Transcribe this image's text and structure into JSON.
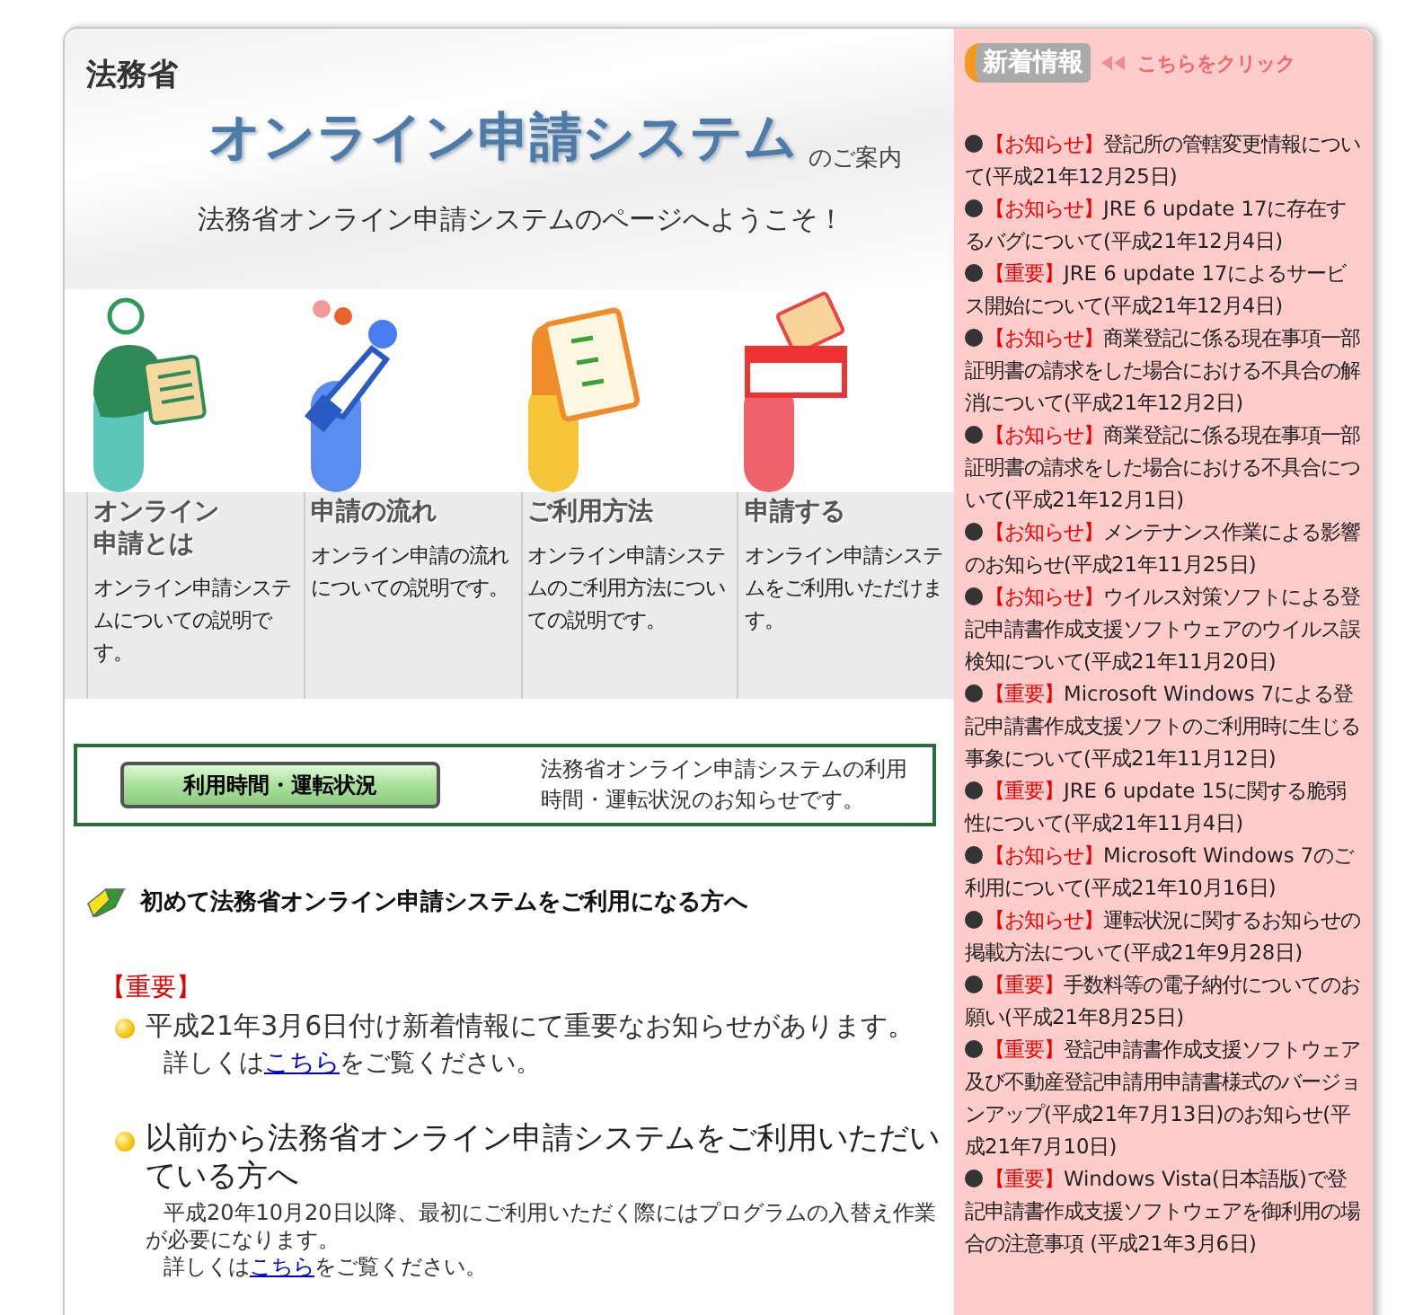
{
  "header": {
    "ministry": "法務省",
    "title": "オンライン申請システム",
    "title_suffix": "のご案内",
    "welcome": "法務省オンライン申請システムのページへようこそ！"
  },
  "nav": [
    {
      "kind": "person",
      "label": "オンライン申請とは",
      "color": "#5cc7b8",
      "description": "オンライン申請システムについての説明です。"
    },
    {
      "kind": "pointer",
      "label": "申請の流れ",
      "color": "#5b8def",
      "description": "オンライン申請の流れについての説明です。"
    },
    {
      "kind": "notebook",
      "label": "ご利用方法",
      "color": "#f6c53a",
      "description": "オンライン申請システムのご利用方法についての説明です。"
    },
    {
      "kind": "mailbox",
      "label": "申請する",
      "color": "#f0626a",
      "description": "オンライン申請システムをご利用いただけます。"
    }
  ],
  "status": {
    "button": "利用時間・運転状況",
    "description": "法務省オンライン申請システムの利用時間・運転状況のお知らせです。"
  },
  "first_time": {
    "heading": "初めて法務省オンライン申請システムをご利用になる方へ",
    "tag": "【重要】",
    "text": "平成21年3月6日付け新着情報にて重要なお知らせがあります。",
    "detail_before": "詳しくは",
    "link": "こちら",
    "detail_after": "をご覧ください。"
  },
  "existing": {
    "heading": "以前から法務省オンライン申請システムをご利用いただいている方へ",
    "text": "平成20年10月20日以降、最初にご利用いただく際にはプログラムの入替え作業が必要になります。",
    "detail_before": "詳しくは",
    "link": "こちら",
    "detail_after": "をご覧ください。"
  },
  "news": {
    "title": "新着情報",
    "more_link": "こちらをクリック",
    "items": [
      {
        "tag": "【お知らせ】",
        "text": "登記所の管轄変更情報について(平成21年12月25日)"
      },
      {
        "tag": "【お知らせ】",
        "text": "JRE 6 update 17に存在するバグについて(平成21年12月4日)"
      },
      {
        "tag": "【重要】",
        "text": "JRE 6 update 17によるサービス開始について(平成21年12月4日)"
      },
      {
        "tag": "【お知らせ】",
        "text": "商業登記に係る現在事項一部証明書の請求をした場合における不具合の解消について(平成21年12月2日)"
      },
      {
        "tag": "【お知らせ】",
        "text": "商業登記に係る現在事項一部証明書の請求をした場合における不具合について(平成21年12月1日)"
      },
      {
        "tag": "【お知らせ】",
        "text": "メンテナンス作業による影響のお知らせ(平成21年11月25日)"
      },
      {
        "tag": "【お知らせ】",
        "text": "ウイルス対策ソフトによる登記申請書作成支援ソフトウェアのウイルス誤検知について(平成21年11月20日)"
      },
      {
        "tag": "【重要】",
        "text": "Microsoft Windows 7による登記申請書作成支援ソフトのご利用時に生じる事象について(平成21年11月12日)"
      },
      {
        "tag": "【重要】",
        "text": "JRE 6 update 15に関する脆弱性について(平成21年11月4日)"
      },
      {
        "tag": "【お知らせ】",
        "text": "Microsoft Windows 7のご利用について(平成21年10月16日)"
      },
      {
        "tag": "【お知らせ】",
        "text": "運転状況に関するお知らせの掲載方法について(平成21年9月28日)"
      },
      {
        "tag": "【重要】",
        "text": "手数料等の電子納付についてのお願い(平成21年8月25日)"
      },
      {
        "tag": "【重要】",
        "text": "登記申請書作成支援ソフトウェア及び不動産登記申請用申請書様式のバージョンアップ(平成21年7月13日)のお知らせ(平成21年7月10日)"
      },
      {
        "tag": "【重要】",
        "text": "Windows Vista(日本語版)で登記申請書作成支援ソフトウェアを御利用の場合の注意事項 (平成21年3月6日)"
      }
    ]
  }
}
